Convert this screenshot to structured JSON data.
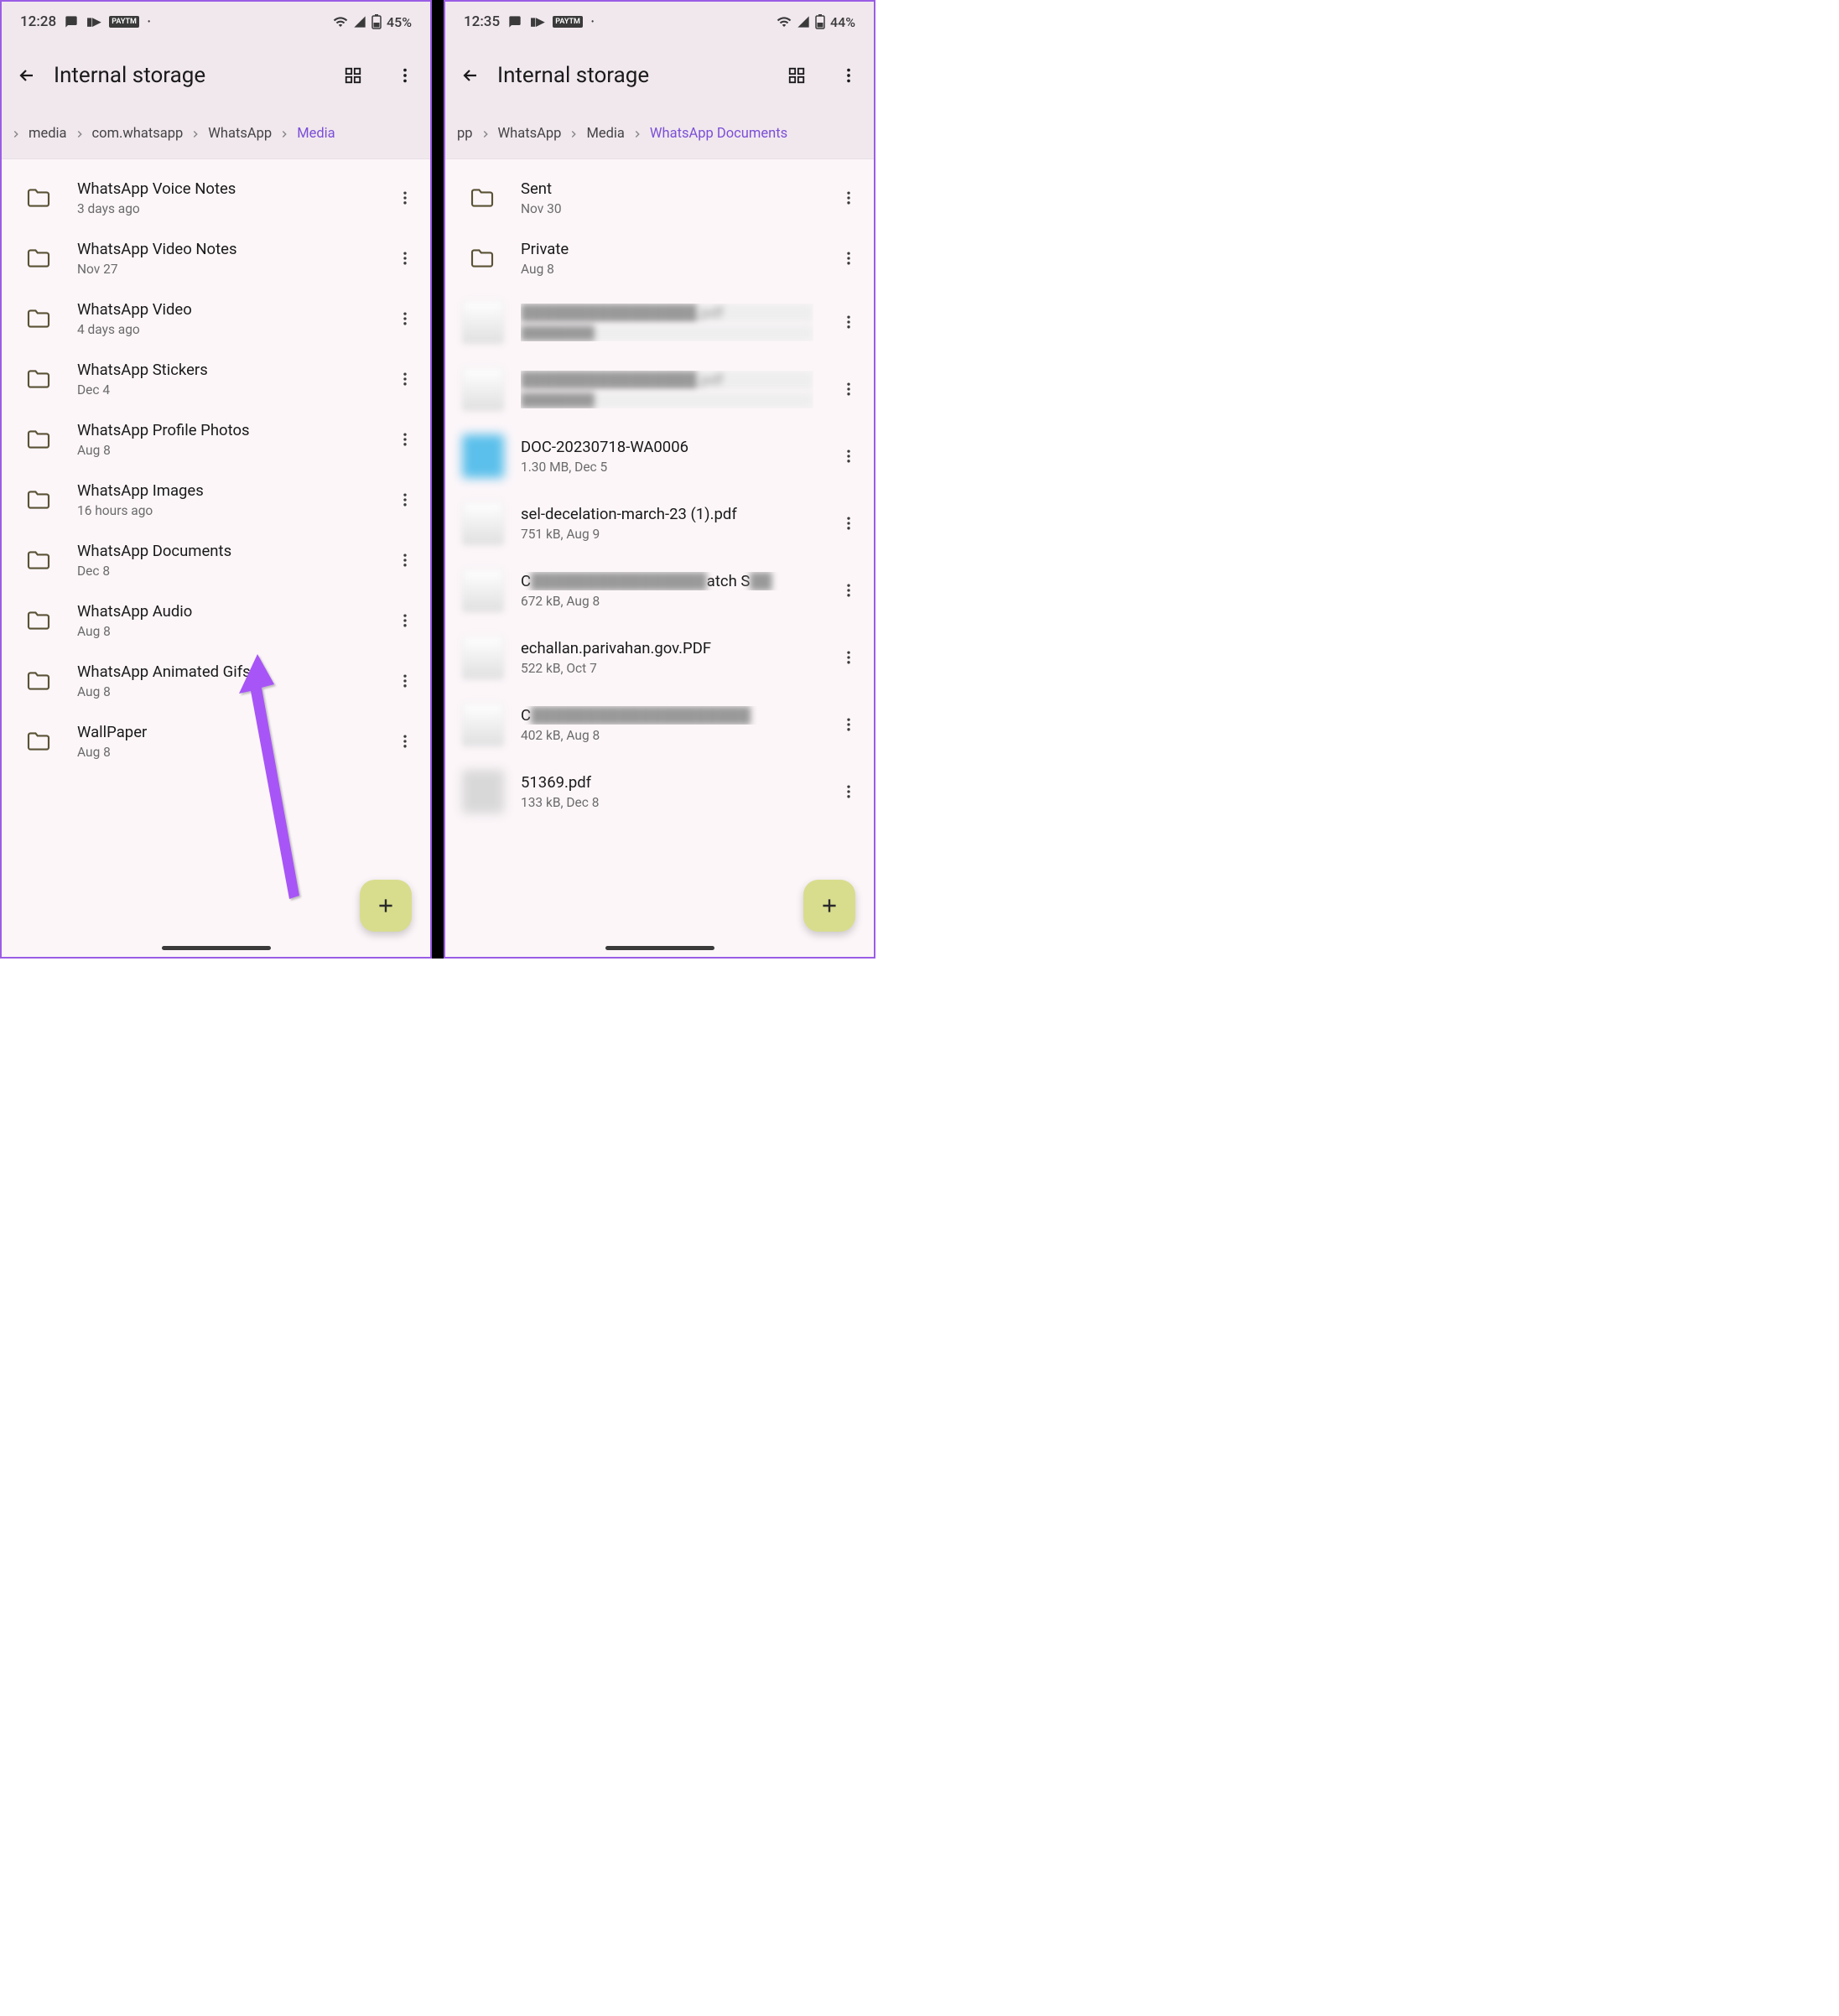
{
  "left": {
    "status": {
      "time": "12:28",
      "battery": "45%"
    },
    "header": {
      "title": "Internal storage"
    },
    "breadcrumb": [
      {
        "label": "media",
        "active": false
      },
      {
        "label": "com.whatsapp",
        "active": false
      },
      {
        "label": "WhatsApp",
        "active": false
      },
      {
        "label": "Media",
        "active": true
      }
    ],
    "items": [
      {
        "type": "folder",
        "name": "WhatsApp Voice Notes",
        "sub": "3 days ago"
      },
      {
        "type": "folder",
        "name": "WhatsApp Video Notes",
        "sub": "Nov 27"
      },
      {
        "type": "folder",
        "name": "WhatsApp Video",
        "sub": "4 days ago"
      },
      {
        "type": "folder",
        "name": "WhatsApp Stickers",
        "sub": "Dec 4"
      },
      {
        "type": "folder",
        "name": "WhatsApp Profile Photos",
        "sub": "Aug 8"
      },
      {
        "type": "folder",
        "name": "WhatsApp Images",
        "sub": "16 hours ago"
      },
      {
        "type": "folder",
        "name": "WhatsApp Documents",
        "sub": "Dec 8"
      },
      {
        "type": "folder",
        "name": "WhatsApp Audio",
        "sub": "Aug 8"
      },
      {
        "type": "folder",
        "name": "WhatsApp Animated Gifs",
        "sub": "Aug 8"
      },
      {
        "type": "folder",
        "name": "WallPaper",
        "sub": "Aug 8"
      }
    ]
  },
  "right": {
    "status": {
      "time": "12:35",
      "battery": "44%"
    },
    "header": {
      "title": "Internal storage"
    },
    "breadcrumb": [
      {
        "label": "pp",
        "active": false
      },
      {
        "label": "WhatsApp",
        "active": false
      },
      {
        "label": "Media",
        "active": false
      },
      {
        "label": "WhatsApp Documents",
        "active": true
      }
    ],
    "items": [
      {
        "type": "folder",
        "name": "Sent",
        "sub": "Nov 30"
      },
      {
        "type": "folder",
        "name": "Private",
        "sub": "Aug 8"
      },
      {
        "type": "blurred",
        "thumb": "pdf",
        "name": "████████████████.pdf",
        "sub": "████████"
      },
      {
        "type": "blurred",
        "thumb": "pdf",
        "name": "████████████████.pdf",
        "sub": "████████"
      },
      {
        "type": "file",
        "thumb": "blue",
        "name": "DOC-20230718-WA0006",
        "sub": "1.30 MB, Dec 5"
      },
      {
        "type": "file",
        "thumb": "pdf",
        "name": "sel-decelation-march-23 (1).pdf",
        "sub": "751 kB, Aug 9"
      },
      {
        "type": "blurredpartial",
        "thumb": "pdf",
        "name_prefix": "C",
        "name_suffix": "atch S",
        "sub": "672 kB, Aug 8"
      },
      {
        "type": "file",
        "thumb": "pdf",
        "name": "echallan.parivahan.gov.PDF",
        "sub": "522 kB, Oct 7"
      },
      {
        "type": "blurredpartial2",
        "thumb": "pdf",
        "name_prefix": "C",
        "sub": "402 kB, Aug 8"
      },
      {
        "type": "file",
        "thumb": "grey",
        "name": "51369.pdf",
        "sub": "133 kB, Dec 8"
      }
    ]
  }
}
